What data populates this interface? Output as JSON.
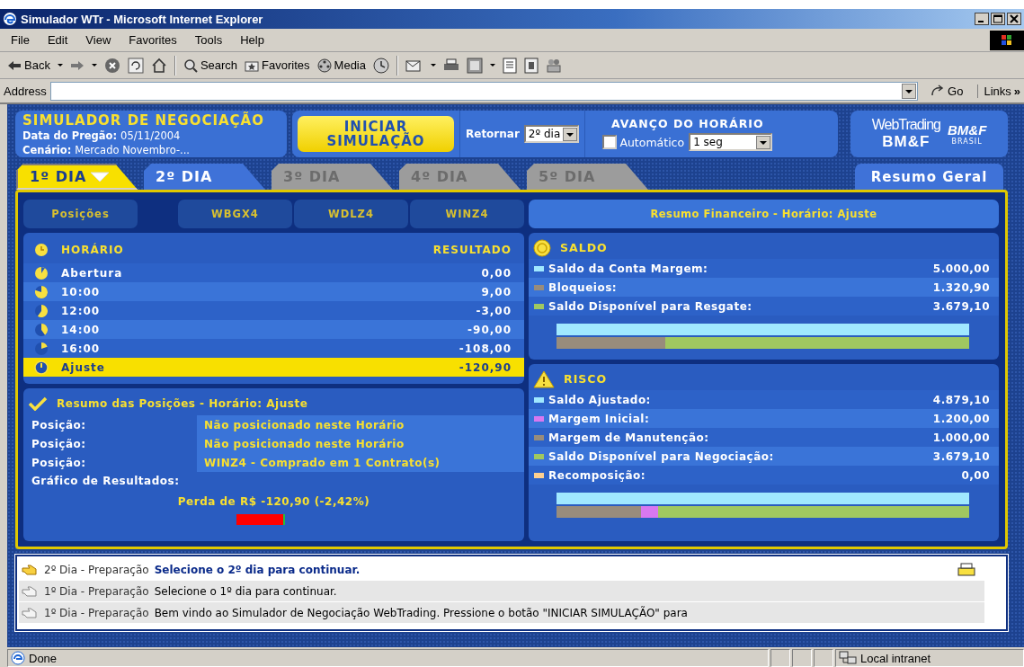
{
  "window": {
    "title": "Simulador WTr - Microsoft Internet Explorer"
  },
  "menu": [
    "File",
    "Edit",
    "View",
    "Favorites",
    "Tools",
    "Help"
  ],
  "toolbar": {
    "back": "Back",
    "search": "Search",
    "favorites": "Favorites",
    "media": "Media"
  },
  "address": {
    "label": "Address",
    "go": "Go",
    "links": "Links",
    "links_more": "»"
  },
  "header": {
    "title": "SIMULADOR DE NEGOCIAÇÃO",
    "date_label": "Data do Pregão:",
    "date": "05/11/2004",
    "scenario_label": "Cenário:",
    "scenario": "Mercado Novembro-...",
    "start_button": [
      "INICIAR",
      "SIMULAÇÃO"
    ],
    "return_label": "Retornar",
    "return_value": "2º dia",
    "advance_title": "AVANÇO DO HORÁRIO",
    "auto_label": "Automático",
    "auto_checked": false,
    "interval": "1 seg",
    "logo": {
      "line1": "WebTrading",
      "line2": "BM&F",
      "mark": "BM&F",
      "mark_sub": "BRASIL"
    }
  },
  "day_tabs": [
    {
      "label": "1º DIA",
      "selected": true,
      "disabled": false
    },
    {
      "label": "2º DIA",
      "selected": false,
      "disabled": false
    },
    {
      "label": "3º DIA",
      "selected": false,
      "disabled": true
    },
    {
      "label": "4º DIA",
      "selected": false,
      "disabled": true
    },
    {
      "label": "5º DIA",
      "selected": false,
      "disabled": true
    }
  ],
  "summary_tab": "Resumo Geral",
  "sub_tabs": [
    "Posições",
    "WBGX4",
    "WDLZ4",
    "WINZ4"
  ],
  "schedule": {
    "columns": [
      "HORÁRIO",
      "RESULTADO"
    ],
    "rows": [
      {
        "time": "Abertura",
        "result": "0,00",
        "selected": false
      },
      {
        "time": "10:00",
        "result": "9,00",
        "selected": false
      },
      {
        "time": "12:00",
        "result": "-3,00",
        "selected": false
      },
      {
        "time": "14:00",
        "result": "-90,00",
        "selected": false
      },
      {
        "time": "16:00",
        "result": "-108,00",
        "selected": false
      },
      {
        "time": "Ajuste",
        "result": "-120,90",
        "selected": true
      }
    ]
  },
  "positions": {
    "title": "Resumo das Posições - Horário: Ajuste",
    "rows": [
      {
        "label": "Posição:",
        "value": "Não posicionado neste Horário"
      },
      {
        "label": "Posição:",
        "value": "Não posicionado neste Horário"
      },
      {
        "label": "Posição:",
        "value": "WINZ4 - Comprado em 1 Contrato(s)"
      }
    ],
    "chart_label": "Gráfico de Resultados:",
    "result_text": "Perda de R$ -120,90 (-2,42%)"
  },
  "financial": {
    "title": "Resumo Financeiro - Horário: Ajuste",
    "sections": [
      {
        "kind": "balance",
        "title": "SALDO",
        "items": [
          {
            "label": "Saldo da Conta Margem:",
            "value": "5.000,00",
            "color": "#a0e8ff"
          },
          {
            "label": "Bloqueios:",
            "value": "1.320,90",
            "color": "#988c7c"
          },
          {
            "label": "Saldo Disponível para Resgate:",
            "value": "3.679,10",
            "color": "#a0c860"
          }
        ]
      },
      {
        "kind": "risk",
        "title": "RISCO",
        "items": [
          {
            "label": "Saldo Ajustado:",
            "value": "4.879,10",
            "color": "#a0e8ff"
          },
          {
            "label": "Margem Inicial:",
            "value": "1.200,00",
            "color": "#d878f0"
          },
          {
            "label": "Margem de Manutenção:",
            "value": "1.000,00",
            "color": "#988c7c"
          },
          {
            "label": "Saldo Disponível para Negociação:",
            "value": "3.679,10",
            "color": "#a0c860"
          },
          {
            "label": "Recomposição:",
            "value": "0,00",
            "color": "#ffd090"
          }
        ]
      }
    ]
  },
  "log": [
    {
      "stage": "2º Dia - Preparação",
      "message": "Selecione o 2º dia para continuar.",
      "current": true
    },
    {
      "stage": "1º Dia - Preparação",
      "message": "Selecione o 1º dia para continuar.",
      "current": false
    },
    {
      "stage": "1º Dia - Preparação",
      "message": "Bem vindo ao Simulador de Negociação WebTrading. Pressione o botão \"INICIAR SIMULAÇÃO\" para",
      "current": false
    }
  ],
  "status_bar": {
    "text": "Done",
    "zone": "Local intranet"
  }
}
